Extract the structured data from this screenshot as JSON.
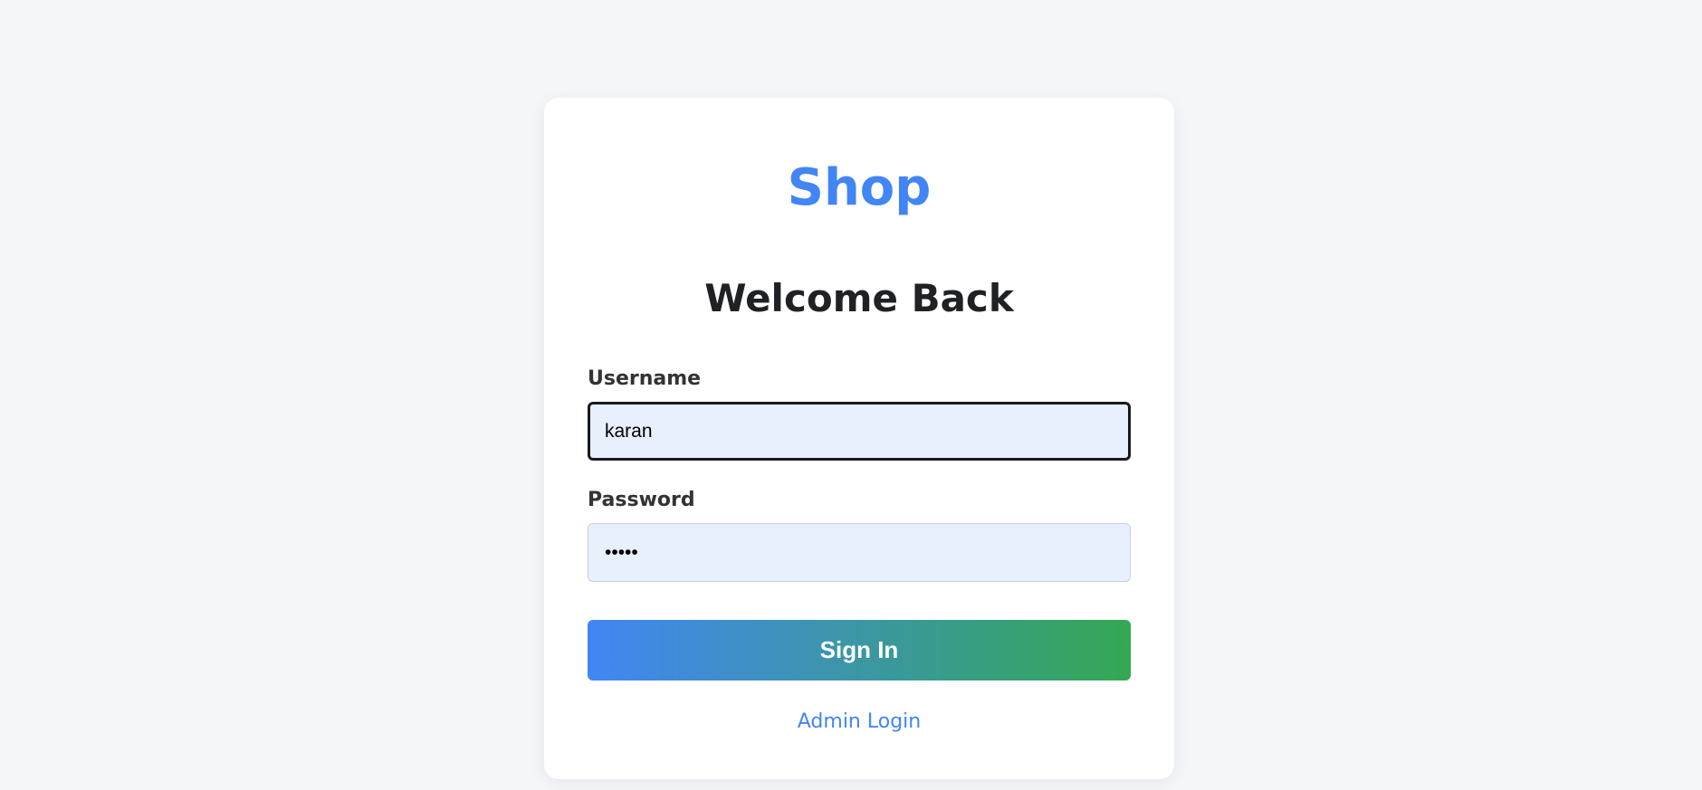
{
  "brand": "Shop",
  "title": "Welcome Back",
  "form": {
    "username_label": "Username",
    "username_value": "karan",
    "password_label": "Password",
    "password_value": "karan",
    "submit_label": "Sign In"
  },
  "admin_link": "Admin Login",
  "colors": {
    "accent": "#4285f4",
    "gradient_end": "#34a853",
    "input_bg": "#e8f0fe"
  }
}
